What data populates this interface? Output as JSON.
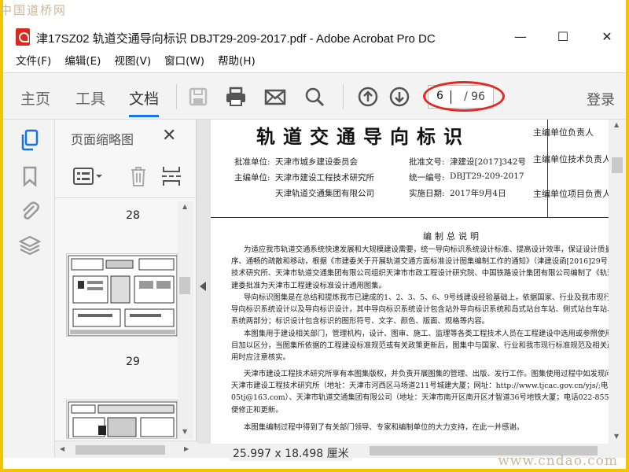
{
  "watermarks": {
    "top_left": "中国道桥网",
    "bottom_right": "www.cndao.com"
  },
  "window": {
    "title": "津17SZ02 轨道交通导向标识 DBJT29-209-2017.pdf - Adobe Acrobat Pro DC",
    "minimize": "—",
    "maximize": "☐",
    "close": "✕"
  },
  "menu": [
    "文件(F)",
    "编辑(E)",
    "视图(V)",
    "窗口(W)",
    "帮助(H)"
  ],
  "toolbar": {
    "tabs": [
      "主页",
      "工具",
      "文档"
    ],
    "active_tab": "文档",
    "icons": [
      "save-icon",
      "print-icon",
      "email-icon",
      "search-icon",
      "page-up-icon",
      "page-down-icon"
    ],
    "page_current": "6",
    "page_total": "/ 96",
    "signin": "登录",
    "highlight_color": "#e02a20",
    "accent_color": "#1473e6"
  },
  "rail": {
    "icons": [
      "page-thumbnails-icon",
      "bookmark-icon",
      "attachment-icon",
      "layers-icon"
    ],
    "active_color": "#1473e6"
  },
  "thumbnails": {
    "title": "页面缩略图",
    "close": "✕",
    "pages": [
      "28",
      "29"
    ]
  },
  "document": {
    "title": "轨道交通导向标识",
    "approval_unit_label": "批准单位:",
    "approval_unit": "天津市城乡建设委员会",
    "approval_doc_label": "批准文号:",
    "approval_doc": "津建设[2017]342号",
    "editor_label": "主编单位:",
    "editor_1": "天津市建设工程技术研究所",
    "editor_2": "天津轨道交通集团有限公司",
    "code_label": "统一编号:",
    "code": "DBJT29-209-2017",
    "date_label": "实施日期:",
    "date": "2017年9月4日",
    "side_1": "主编单位负责人",
    "side_2": "主编单位技术负责人",
    "side_3": "主编单位项目负责人",
    "section_title": "编制总说明",
    "paragraphs": [
      [
        "为适应我市轨道交通系统快速发展和大规模建设需要，统一导向标识系统设计标准、提高设计效率，保证设计质量、以实现",
        "序、通畅的疏散和移动，根据《市建委关于开展轨道交通方面标准设计图集编制工作的通知》（津建设函[2016]29号）的要求，由",
        "技术研究所、天津市轨道交通集团有限公司组织天津市市政工程设计研究院、中国铁路设计集团有限公司编制了《轨道交通导向",
        "建委批准为天津市工程建设标准设计通用图集。"
      ],
      [
        "导向标识图集是在总结和提炼我市已建成的1、2、3、5、6、9号线建设经验基础上，依据国家、行业及我市现行标准和规范",
        "导向标识系统设计以及导向标识设计，其中导向标识系统设计包含站外导向标识系统和岛式站台车站、侧式站台车站、换乘车",
        "系统两部分；标识设计包含标识的图形符号、文字、颜色、版面、规格等内容。"
      ],
      [
        "本图集用于建设相关部门，管理机构，设计、图审、施工、监理等各类工程技术人员在工程建设中选用或参照使用，使用本",
        "目加以区分，当图集所依据的工程建设标准规范或有关政策更新后，图集中与国家、行业和我市现行标准规范及相关政策不符的",
        "用时应注意核实。"
      ],
      [
        "天津市建设工程技术研究所享有本图集版权，并负责开展图集的管理、出版、发行工作。图集使用过程中如发现问题或有意",
        "天津市建设工程技术研究所（地址：天津市河西区马场道211号城建大厦；网址：http://www.tjcac.gov.cn/yjs/;电话：022-231",
        "05tj@163.com）、天津市轨道交通集团有限公司（地址：天津市南开区南开区才智道36号地铁大厦；电话022-85568800，邮箱qq4677",
        "便修正和更新。"
      ],
      [
        "本图集编制过程中得到了有关部门领导、专家和编制单位的大力支持，在此一并感谢。"
      ]
    ],
    "dimensions": "25.997 x 18.498 厘米"
  }
}
